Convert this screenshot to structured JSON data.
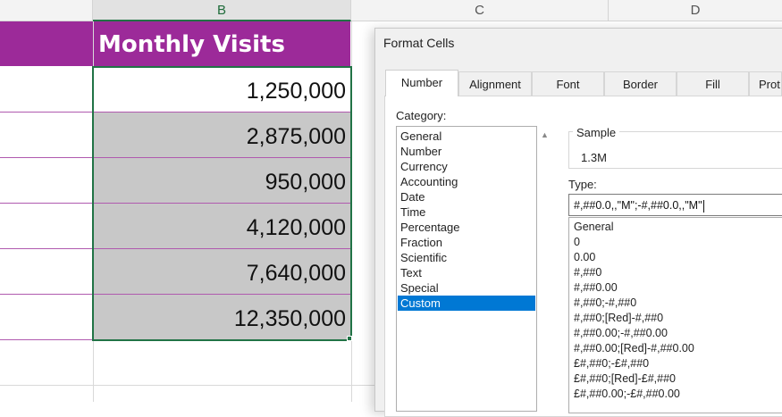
{
  "sheet": {
    "columns": [
      "B",
      "C",
      "D"
    ],
    "selected_column": "B",
    "header_title": "Monthly Visits",
    "values": [
      "1,250,000",
      "2,875,000",
      "950,000",
      "4,120,000",
      "7,640,000",
      "12,350,000"
    ],
    "colors": {
      "title_band": "#9c2a99",
      "selection": "#217346",
      "shaded_cell": "#c8c8c8"
    }
  },
  "dialog": {
    "title": "Format Cells",
    "tabs": [
      "Number",
      "Alignment",
      "Font",
      "Border",
      "Fill",
      "Prot"
    ],
    "active_tab": "Number",
    "category_label": "Category:",
    "categories": [
      "General",
      "Number",
      "Currency",
      "Accounting",
      "Date",
      "Time",
      "Percentage",
      "Fraction",
      "Scientific",
      "Text",
      "Special",
      "Custom"
    ],
    "selected_category": "Custom",
    "sample_label": "Sample",
    "sample_value": "1.3M",
    "type_label": "Type:",
    "type_value": "#,##0.0,,\"M\";-#,##0.0,,\"M\"",
    "type_formats": [
      "General",
      "0",
      "0.00",
      "#,##0",
      "#,##0.00",
      "#,##0;-#,##0",
      "#,##0;[Red]-#,##0",
      "#,##0.00;-#,##0.00",
      "#,##0.00;[Red]-#,##0.00",
      "£#,##0;-£#,##0",
      "£#,##0;[Red]-£#,##0",
      "£#,##0.00;-£#,##0.00"
    ],
    "accent_color": "#0078d4"
  }
}
